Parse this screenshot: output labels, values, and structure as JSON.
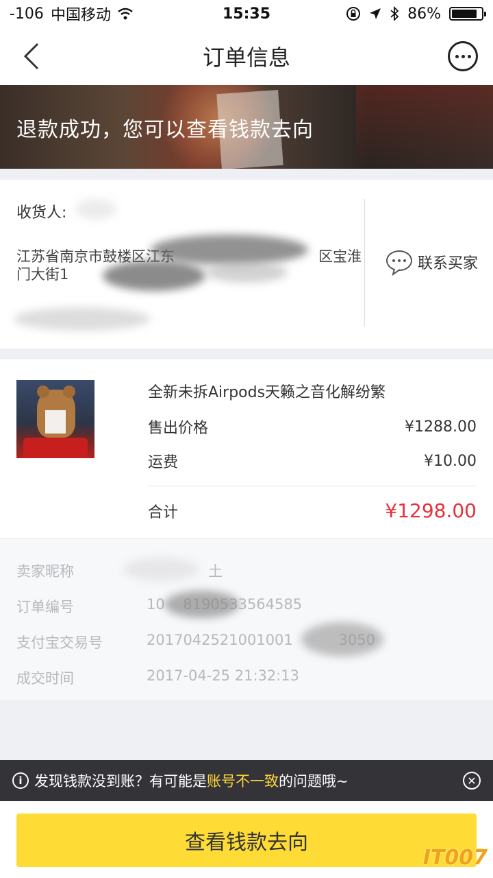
{
  "status_bar": {
    "signal": "-106",
    "carrier": "中国移动",
    "time": "15:35",
    "battery": "86%",
    "battery_level": 0.86
  },
  "nav": {
    "title": "订单信息"
  },
  "banner": {
    "text": "退款成功，您可以查看钱款去向"
  },
  "address": {
    "recipient_label": "收货人:",
    "address_line1": "江苏省南京市鼓楼区江东",
    "address_line1_tail": "区宝淮",
    "address_line2": "门大街1",
    "contact_label": "联系买家"
  },
  "product": {
    "title": "全新未拆Airpods天籁之音化解纷繁",
    "rows": [
      {
        "label": "售出价格",
        "value": "¥1288.00"
      },
      {
        "label": "运费",
        "value": "¥10.00"
      }
    ],
    "total_label": "合计",
    "total_value": "¥1298.00"
  },
  "info": {
    "rows": [
      {
        "label": "卖家昵称",
        "value": "土"
      },
      {
        "label": "订单编号",
        "value": "10    8190533564585"
      },
      {
        "label": "支付宝交易号",
        "value": "2017042521001001          3050"
      },
      {
        "label": "成交时间",
        "value": "2017-04-25 21:32:13"
      }
    ]
  },
  "notice": {
    "text_before": "发现钱款没到账？有可能是",
    "highlight": "账号不一致",
    "text_after": "的问题哦~",
    "highlight_color": "#ffd43a"
  },
  "cta": {
    "label": "查看钱款去向",
    "color": "#ffdc35"
  },
  "watermark": "IT007",
  "icons": [
    "back-chevron-icon",
    "more-dots-icon",
    "wifi-icon",
    "lock-rotation-icon",
    "location-arrow-icon",
    "bluetooth-icon",
    "battery-icon",
    "chat-bubble-icon",
    "info-icon",
    "close-circle-icon"
  ]
}
